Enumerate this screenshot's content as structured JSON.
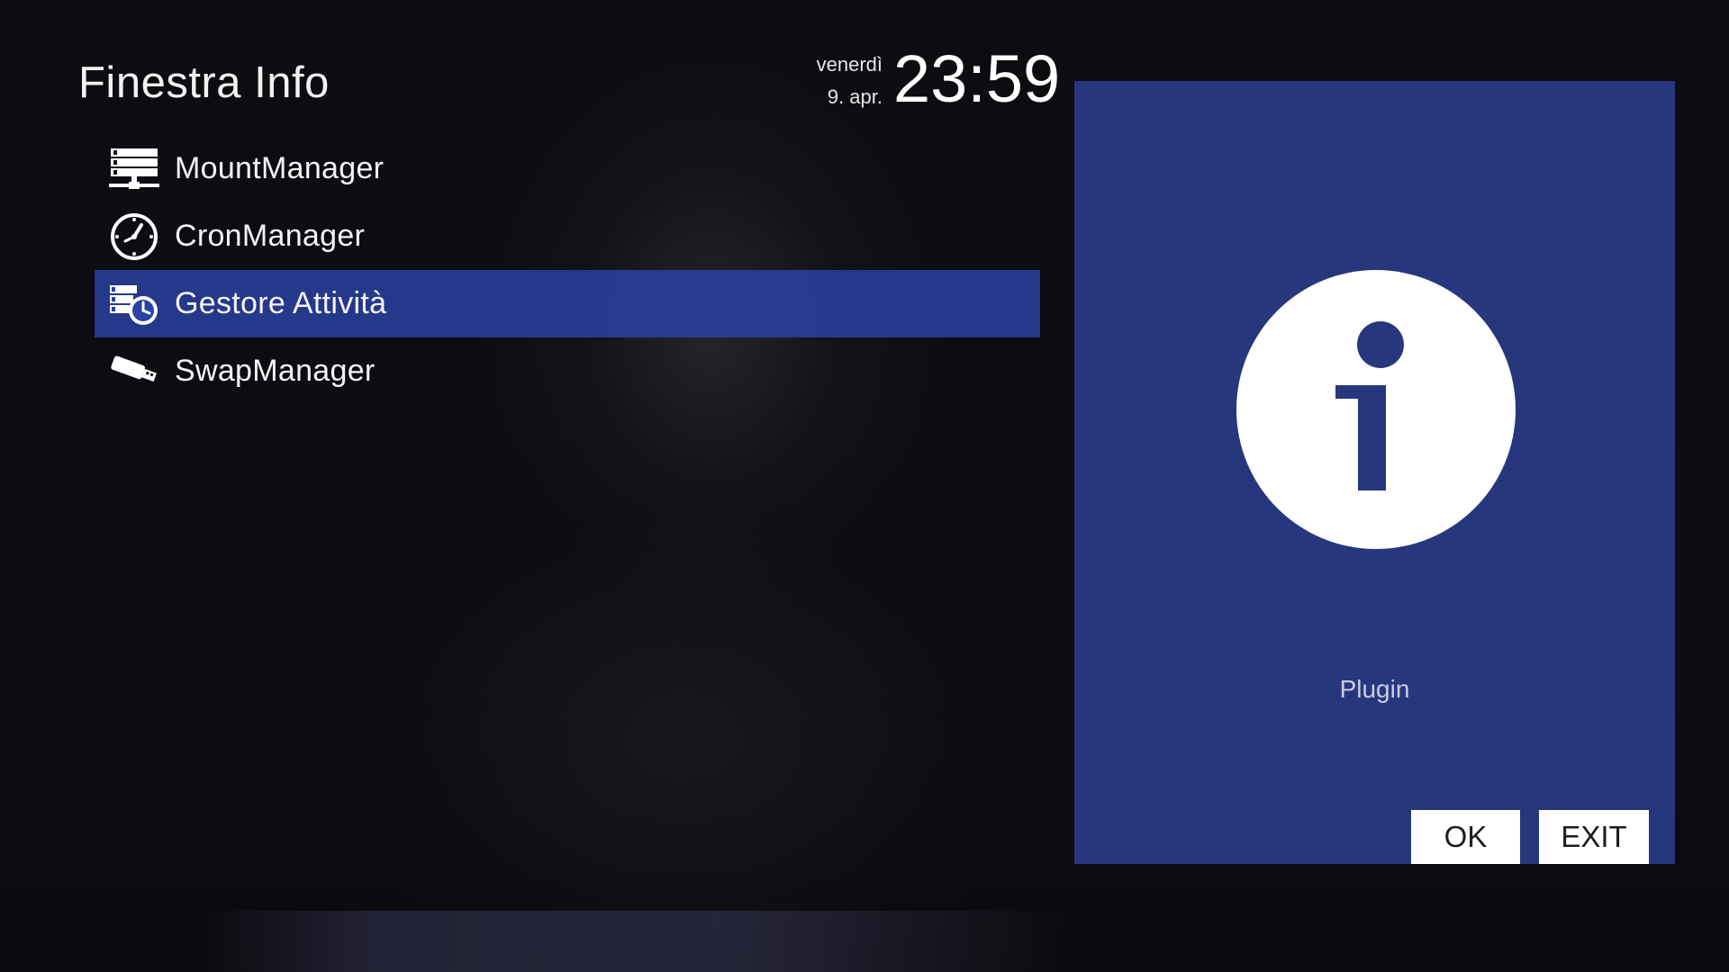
{
  "header": {
    "title": "Finestra Info",
    "day": "venerdì",
    "date": "9. apr.",
    "time": "23:59"
  },
  "menu": {
    "items": [
      {
        "label": "MountManager",
        "icon": "network-server-icon"
      },
      {
        "label": "CronManager",
        "icon": "clock-icon"
      },
      {
        "label": "Gestore Attività",
        "icon": "task-scheduler-icon",
        "selected": true
      },
      {
        "label": "SwapManager",
        "icon": "usb-drive-icon"
      }
    ]
  },
  "panel": {
    "icon": "info-icon",
    "caption": "Plugin",
    "background": "#27377d"
  },
  "buttons": {
    "ok_label": "OK",
    "exit_label": "EXIT"
  },
  "colors": {
    "selection": "#2b42a5",
    "panel": "#27377d"
  }
}
